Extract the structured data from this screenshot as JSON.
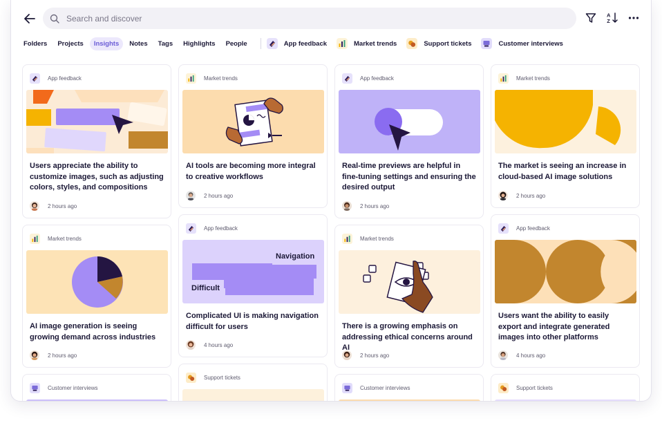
{
  "search": {
    "placeholder": "Search and discover"
  },
  "toolbar": {
    "back_icon": "arrow-left-icon",
    "filter_icon": "filter-icon",
    "sort_icon": "sort-az-icon",
    "more_icon": "more-horizontal-icon"
  },
  "tabs": [
    {
      "label": "Folders",
      "active": false
    },
    {
      "label": "Projects",
      "active": false
    },
    {
      "label": "Insights",
      "active": true
    },
    {
      "label": "Notes",
      "active": false
    },
    {
      "label": "Tags",
      "active": false
    },
    {
      "label": "Highlights",
      "active": false
    },
    {
      "label": "People",
      "active": false
    }
  ],
  "chips": [
    {
      "label": "App feedback",
      "icon": "app-feedback-icon"
    },
    {
      "label": "Market trends",
      "icon": "market-trends-icon"
    },
    {
      "label": "Support tickets",
      "icon": "support-tickets-icon"
    },
    {
      "label": "Customer interviews",
      "icon": "customer-interviews-icon"
    }
  ],
  "colors": {
    "accent": "#6a5bd6",
    "active_tab_bg": "#ece8fc",
    "peach": "#fde3c0",
    "lavender": "#bfb2f8",
    "amber": "#f5b301",
    "ochre": "#c98b2f"
  },
  "cards": [
    {
      "tag": "App feedback",
      "title": "Users appreciate the ability to customize images, such as adjusting colors, styles, and compositions",
      "time": "2 hours ago"
    },
    {
      "tag": "Market trends",
      "title": "AI tools are becoming more integral to creative workflows",
      "time": "2 hours ago"
    },
    {
      "tag": "App feedback",
      "title": "Real-time previews are helpful in fine-tuning settings and ensuring the desired output",
      "time": "2 hours ago"
    },
    {
      "tag": "Market trends",
      "title": "The market is seeing an increase in cloud-based AI image solutions",
      "time": "2 hours ago"
    },
    {
      "tag": "Market trends",
      "title": "AI image generation is seeing growing demand across industries",
      "time": "2 hours ago"
    },
    {
      "tag": "App feedback",
      "title": "Complicated UI is making navigation difficult for users",
      "time": "4 hours ago",
      "illu_labels": [
        "Navigation",
        "Difficult"
      ]
    },
    {
      "tag": "Market trends",
      "title": "There is a growing emphasis on addressing ethical concerns around AI",
      "time": "2 hours ago"
    },
    {
      "tag": "App feedback",
      "title": "Users want the ability to easily export and integrate generated images into other platforms",
      "time": "4 hours ago"
    },
    {
      "tag": "Customer interviews"
    },
    {
      "tag": "Support tickets"
    },
    {
      "tag": "Customer interviews"
    },
    {
      "tag": "Support tickets"
    }
  ]
}
